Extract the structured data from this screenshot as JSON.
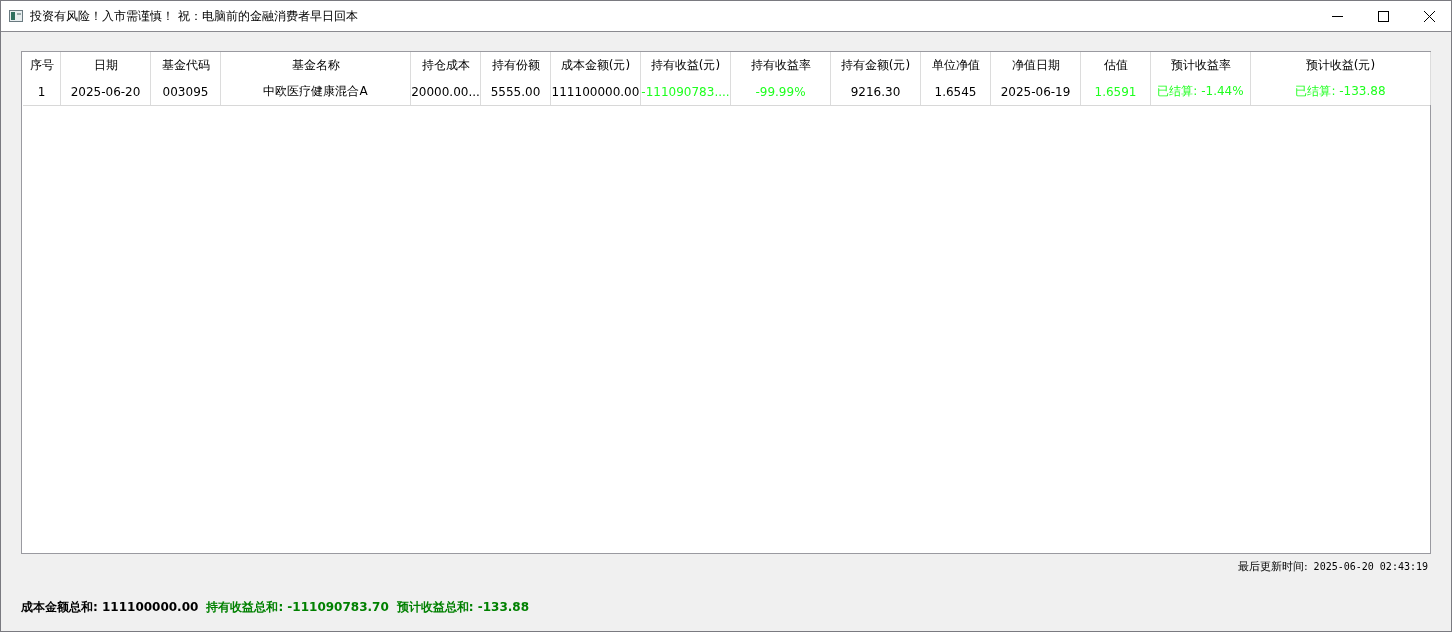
{
  "window": {
    "title": "投资有风险！入市需谨慎！ 祝：电脑前的金融消费者早日回本"
  },
  "table": {
    "columns": [
      "序号",
      "日期",
      "基金代码",
      "基金名称",
      "持仓成本",
      "持有份额",
      "成本金额(元)",
      "持有收益(元)",
      "持有收益率",
      "持有金额(元)",
      "单位净值",
      "净值日期",
      "估值",
      "预计收益率",
      "预计收益(元)"
    ],
    "rows": [
      [
        {
          "text": "1"
        },
        {
          "text": "2025-06-20"
        },
        {
          "text": "003095"
        },
        {
          "text": "中欧医疗健康混合A"
        },
        {
          "text": "20000.00..."
        },
        {
          "text": "5555.00"
        },
        {
          "text": "111100000.00"
        },
        {
          "text": "-111090783....",
          "color": "#1eff1e"
        },
        {
          "text": "-99.99%",
          "color": "#1eff1e"
        },
        {
          "text": "9216.30"
        },
        {
          "text": "1.6545"
        },
        {
          "text": "2025-06-19"
        },
        {
          "text": "1.6591",
          "color": "#1eff1e"
        },
        {
          "text": "已结算: -1.44%",
          "color": "#1eff1e"
        },
        {
          "text": "已结算: -133.88",
          "color": "#1eff1e"
        }
      ]
    ]
  },
  "last_update": {
    "label": "最后更新时间:",
    "value": "2025-06-20 02:43:19"
  },
  "totals": [
    {
      "text": "成本金额总和: 111100000.00",
      "color": "#000000"
    },
    {
      "text": "持有收益总和: -111090783.70",
      "color": "#008000"
    },
    {
      "text": "预计收益总和: -133.88",
      "color": "#008000"
    }
  ]
}
